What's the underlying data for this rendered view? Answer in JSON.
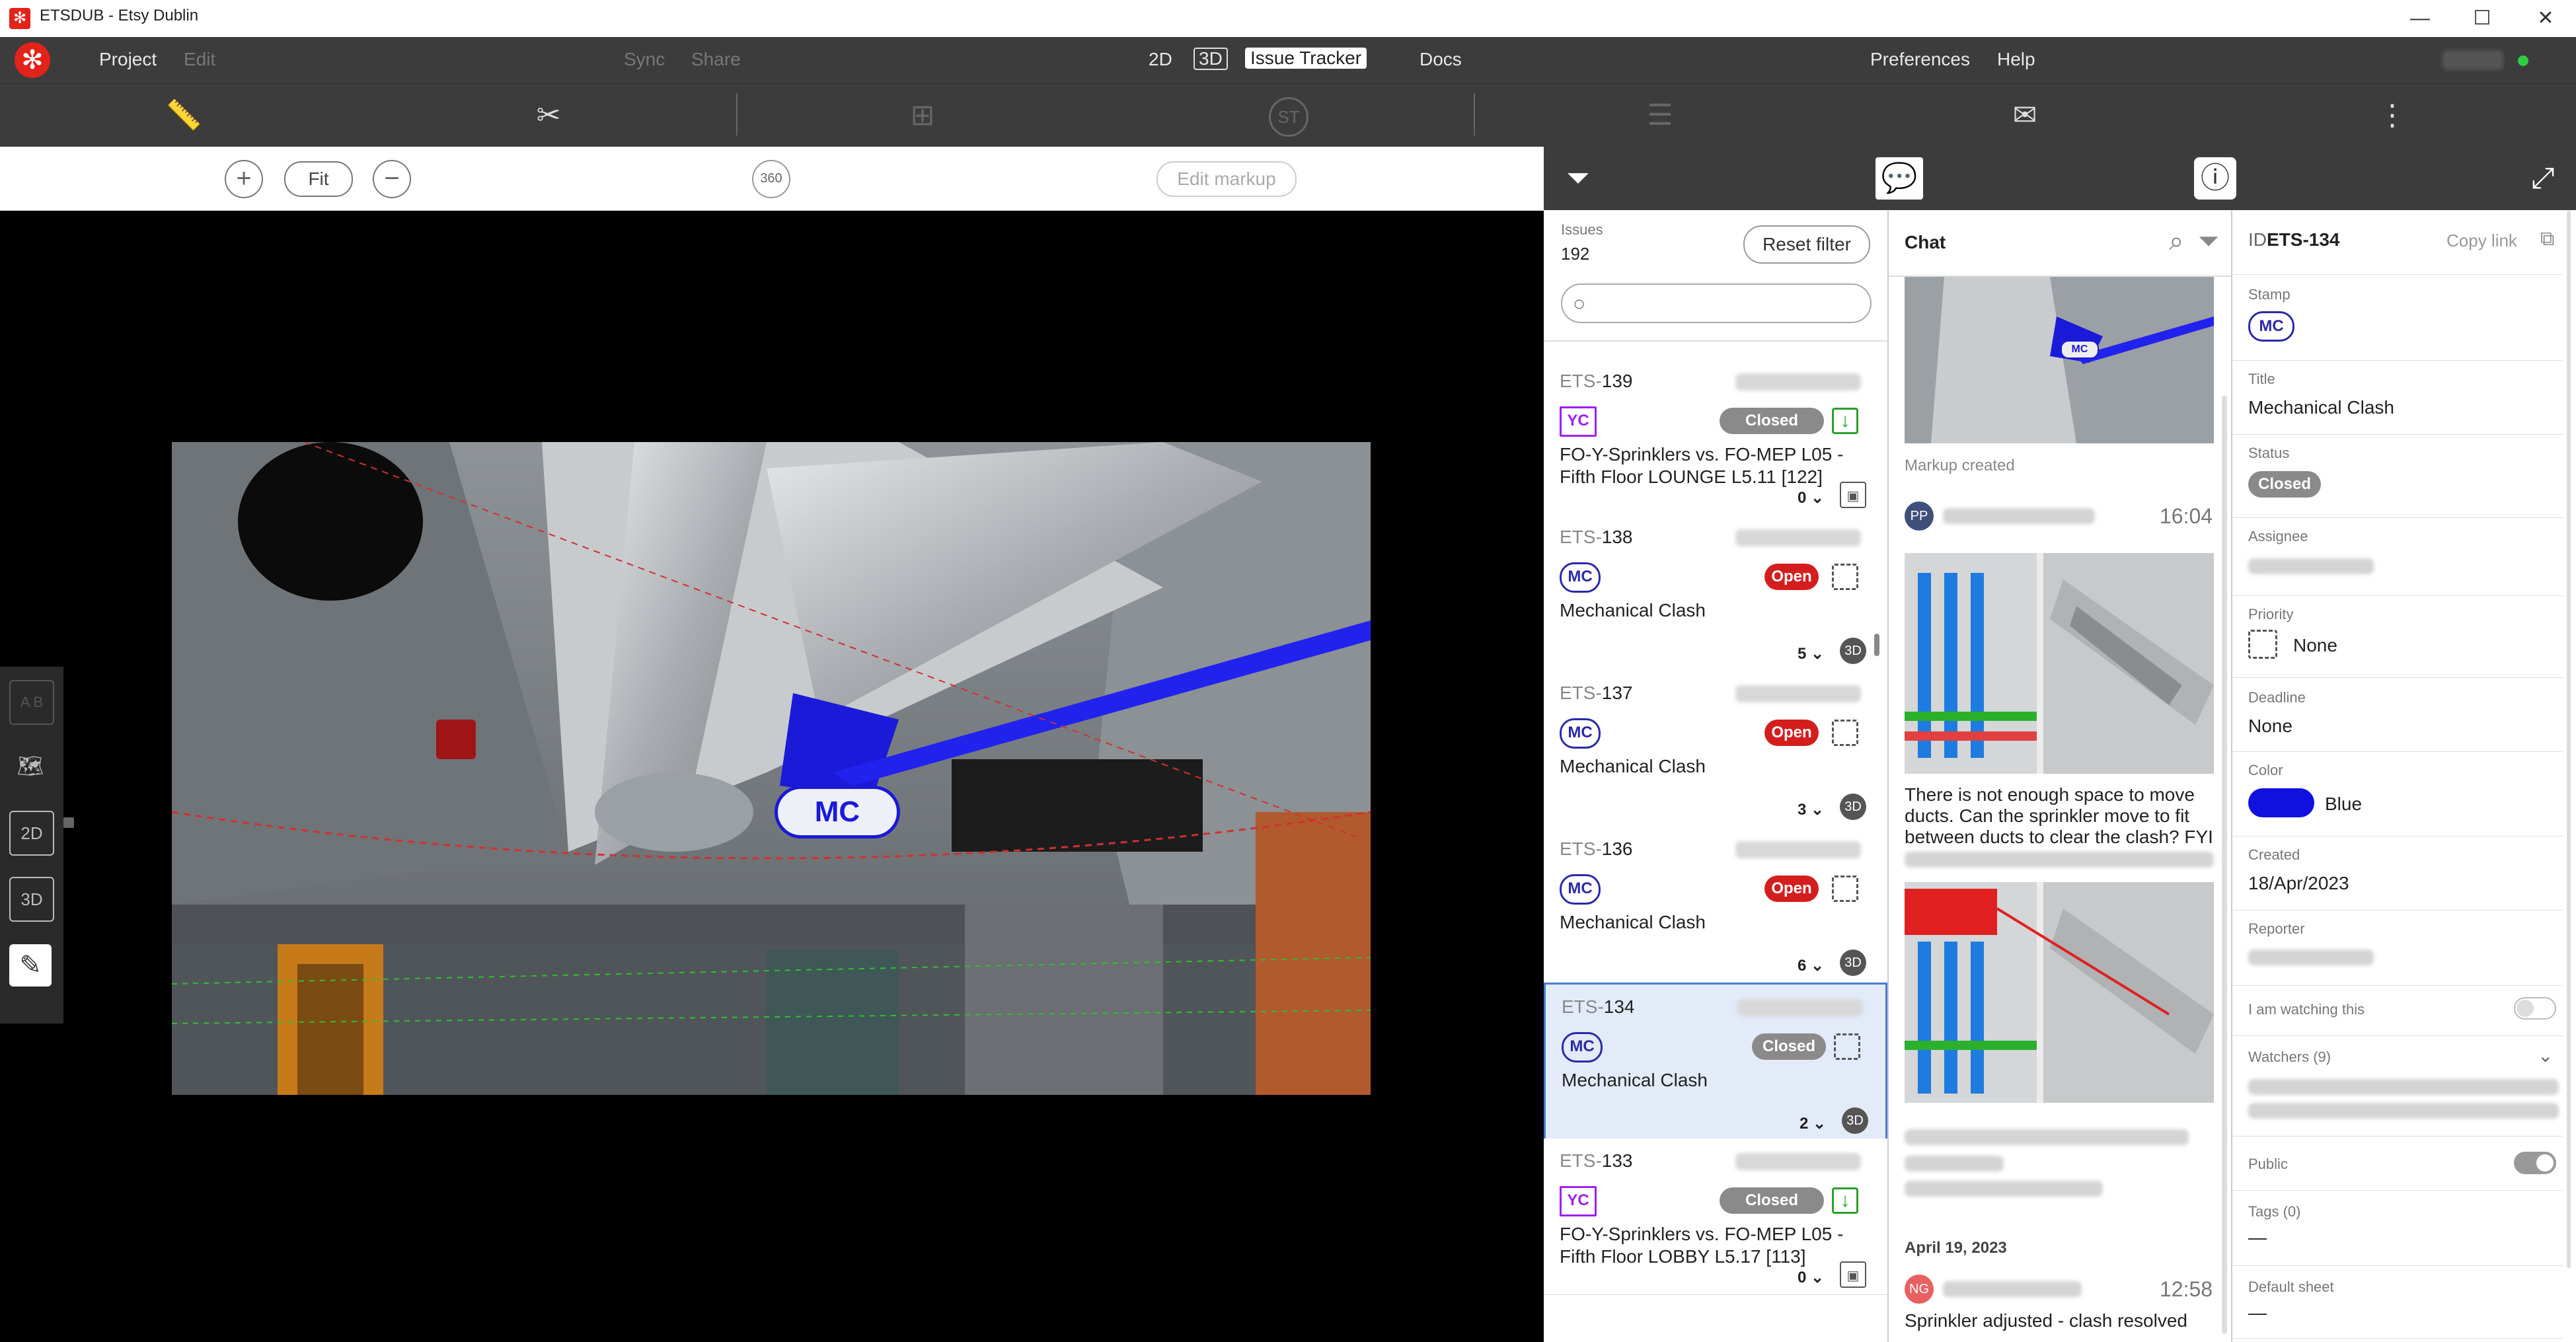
{
  "window": {
    "title": "ETSDUB - Etsy Dublin",
    "minimize": "—",
    "maximize": "☐",
    "close": "✕"
  },
  "menu": {
    "logo": "✻",
    "project": "Project",
    "edit": "Edit",
    "sync": "Sync",
    "share": "Share",
    "view2d": "2D",
    "view3d": "3D",
    "issue_tracker": "Issue Tracker",
    "docs": "Docs",
    "preferences": "Preferences",
    "help": "Help",
    "user_blur": " "
  },
  "toolbar": {
    "ruler": "📏",
    "scissors": "✂",
    "add_comment": "⊞",
    "stamp": "ST",
    "checklist": "☰",
    "issue": "✉",
    "more": "⋮"
  },
  "viewer": {
    "zoom_in": "+",
    "fit": "Fit",
    "zoom_out": "−",
    "view360": "360",
    "edit_markup": "Edit markup",
    "stamp_label": "MC"
  },
  "sidetools": {
    "ab": "A B",
    "map": "🗺",
    "t2d": "2D",
    "t3d": "3D",
    "pen": "✎"
  },
  "panel": {
    "filter": "⏷",
    "chat": "💬",
    "info": "ⓘ",
    "expand": "⤢"
  },
  "issues": {
    "label": "Issues",
    "count": "192",
    "reset": "Reset filter",
    "search_placeholder": "",
    "items": [
      {
        "prefix": "ETS-",
        "num": "139",
        "stamp": "YC",
        "status": "Closed",
        "title": "FO-Y-Sprinklers vs. FO-MEP L05 - Fifth Floor LOUNGE L5.11 [122]",
        "count": "0"
      },
      {
        "prefix": "ETS-",
        "num": "138",
        "stamp": "MC",
        "status": "Open",
        "title": "Mechanical Clash",
        "count": "5"
      },
      {
        "prefix": "ETS-",
        "num": "137",
        "stamp": "MC",
        "status": "Open",
        "title": "Mechanical Clash",
        "count": "3"
      },
      {
        "prefix": "ETS-",
        "num": "136",
        "stamp": "MC",
        "status": "Open",
        "title": "Mechanical Clash",
        "count": "6"
      },
      {
        "prefix": "ETS-",
        "num": "134",
        "stamp": "MC",
        "status": "Closed",
        "title": "Mechanical Clash",
        "count": "2"
      },
      {
        "prefix": "ETS-",
        "num": "133",
        "stamp": "YC",
        "status": "Closed",
        "title": "FO-Y-Sprinklers vs. FO-MEP L05 - Fifth Floor LOBBY L5.17 [113]",
        "count": "0"
      }
    ],
    "chevron": "⌄",
    "type3d": "3D"
  },
  "chat": {
    "title": "Chat",
    "markup_created": "Markup created",
    "pp_initials": "PP",
    "pp_time": "16:04",
    "message1": "There is not enough space to move ducts. Can the sprinkler move to fit between ducts to clear the clash? FYI",
    "date": "April 19, 2023",
    "ng_initials": "NG",
    "ng_time": "12:58",
    "message2": "Sprinkler adjusted - clash resolved",
    "img_stamp": "MC"
  },
  "details": {
    "id_label": "ID",
    "id": "ETS-134",
    "copy_link": "Copy link",
    "stamp_label": "Stamp",
    "stamp": "MC",
    "title_label": "Title",
    "title": "Mechanical Clash",
    "status_label": "Status",
    "status": "Closed",
    "assignee_label": "Assignee",
    "priority_label": "Priority",
    "priority": "None",
    "deadline_label": "Deadline",
    "deadline": "None",
    "color_label": "Color",
    "color_name": "Blue",
    "color_hex": "#1010e0",
    "created_label": "Created",
    "created": "18/Apr/2023",
    "reporter_label": "Reporter",
    "watching_label": "I am watching this",
    "watchers_label": "Watchers (9)",
    "public_label": "Public",
    "tags_label": "Tags (0)",
    "tags": "—",
    "default_sheet_label": "Default sheet",
    "default_sheet": "—"
  }
}
